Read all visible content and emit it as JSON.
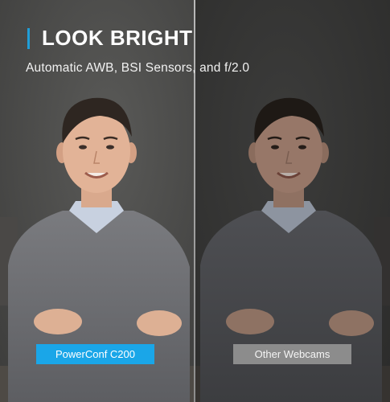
{
  "headline": {
    "title": "LOOK BRIGHT",
    "subtitle": "Automatic AWB, BSI Sensors, and f/2.0"
  },
  "comparison": {
    "left_label": "PowerConf C200",
    "right_label": "Other Webcams"
  },
  "colors": {
    "accent": "#1f9ed8",
    "left_label_bg": "#1aa6e8",
    "right_label_bg": "#8c8c8c"
  }
}
